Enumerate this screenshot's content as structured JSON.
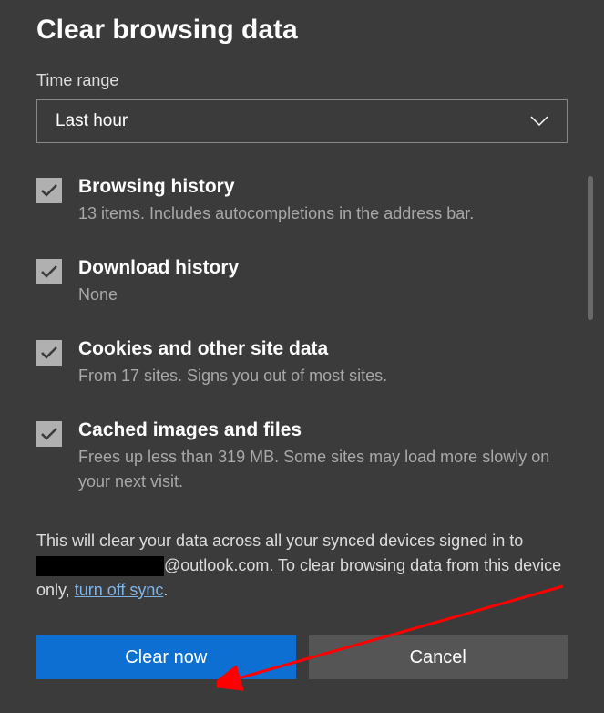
{
  "title": "Clear browsing data",
  "timeRange": {
    "label": "Time range",
    "value": "Last hour"
  },
  "options": [
    {
      "title": "Browsing history",
      "desc": "13 items. Includes autocompletions in the address bar."
    },
    {
      "title": "Download history",
      "desc": "None"
    },
    {
      "title": "Cookies and other site data",
      "desc": "From 17 sites. Signs you out of most sites."
    },
    {
      "title": "Cached images and files",
      "desc": "Frees up less than 319 MB. Some sites may load more slowly on your next visit."
    }
  ],
  "footer": {
    "part1": "This will clear your data across all your synced devices signed in to ",
    "email": "@outlook.com",
    "part2": ". To clear browsing data from this device only, ",
    "link": "turn off sync",
    "part3": "."
  },
  "buttons": {
    "primary": "Clear now",
    "secondary": "Cancel"
  }
}
